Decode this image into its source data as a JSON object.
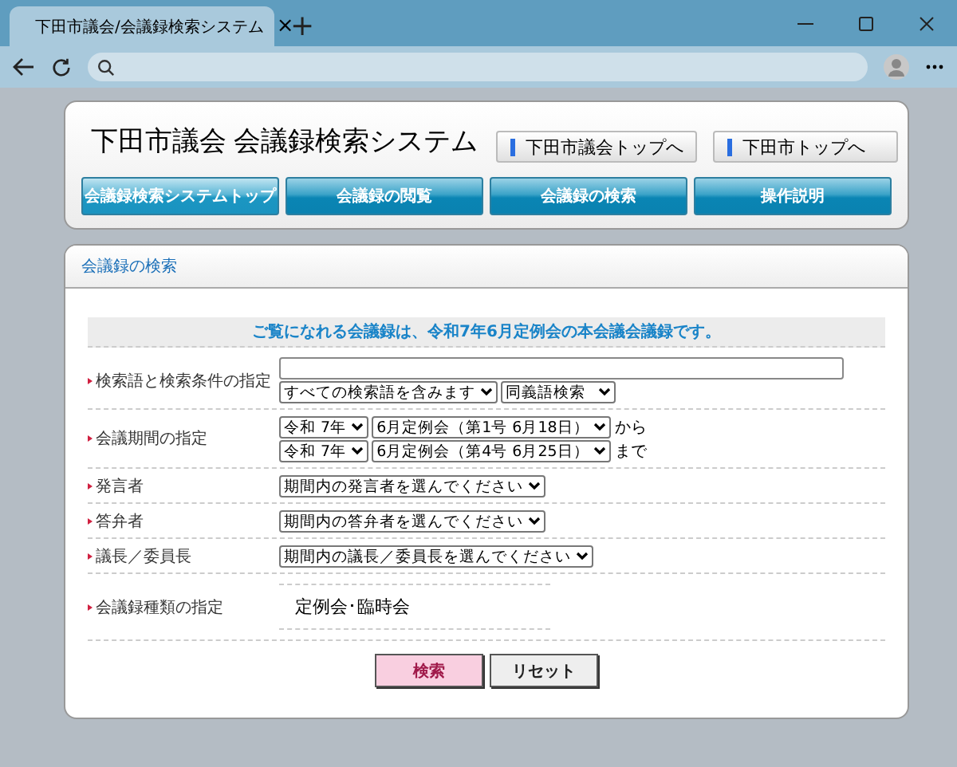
{
  "browser": {
    "tab_title": "下田市議会/会議録検索システム",
    "tab_close": "×",
    "new_tab": "+"
  },
  "header": {
    "site_title": "下田市議会 会議録検索システム",
    "links": [
      "下田市議会トップへ",
      "下田市トップへ"
    ],
    "nav": [
      {
        "label": "会議録検索システムトップ",
        "selected": true
      },
      {
        "label": "会議録の閲覧",
        "selected": false
      },
      {
        "label": "会議録の検索",
        "selected": false
      },
      {
        "label": "操作説明",
        "selected": false
      }
    ]
  },
  "panel": {
    "title": "会議録の検索",
    "notice": "ご覧になれる会議録は、令和7年6月定例会の本会議会議録です。",
    "rows": [
      {
        "kind": "keyword",
        "label": "検索語と検索条件の指定",
        "selects": [
          "すべての検索語を含みます",
          "同義語検索"
        ]
      },
      {
        "kind": "period",
        "label": "会議期間の指定",
        "lines": [
          {
            "year": "令和 7年",
            "meeting": "6月定例会（第1号 6月18日）",
            "suffix": "から"
          },
          {
            "year": "令和 7年",
            "meeting": "6月定例会（第4号 6月25日）",
            "suffix": "まで"
          }
        ]
      },
      {
        "kind": "select",
        "label": "発言者",
        "value": "期間内の発言者を選んでください"
      },
      {
        "kind": "select",
        "label": "答弁者",
        "value": "期間内の答弁者を選んでください"
      },
      {
        "kind": "select",
        "label": "議長／委員長",
        "value": "期間内の議長／委員長を選んでください"
      },
      {
        "kind": "static",
        "label": "会議録種類の指定",
        "value": "定例会･臨時会"
      }
    ],
    "buttons": [
      {
        "kind": "primary",
        "label": "検索"
      },
      {
        "kind": "secondary",
        "label": "リセット"
      }
    ]
  }
}
